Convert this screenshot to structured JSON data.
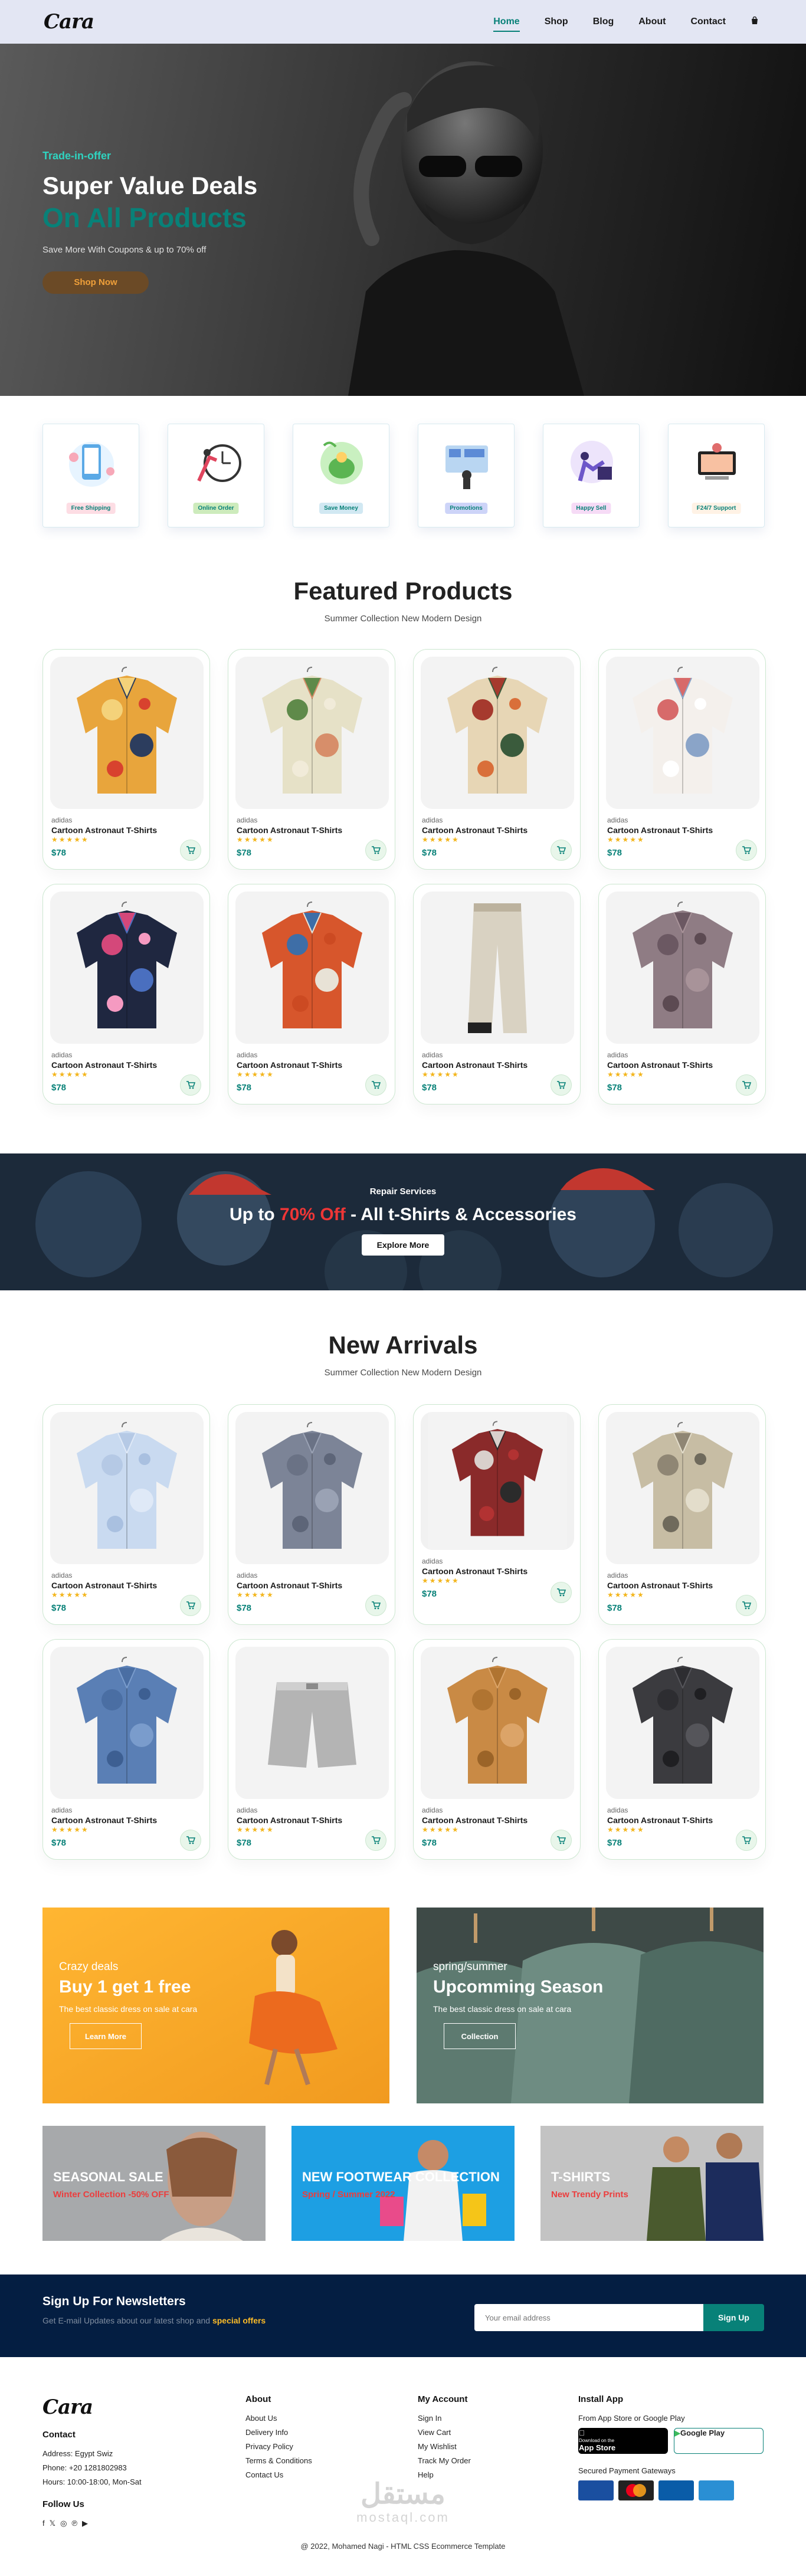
{
  "header": {
    "logo": "Cara",
    "nav": [
      "Home",
      "Shop",
      "Blog",
      "About",
      "Contact"
    ],
    "active": "Home",
    "cart_icon": "shopping-bag-icon"
  },
  "hero": {
    "kicker": "Trade-in-offer",
    "title1": "Super Value Deals",
    "title2": "On All Products",
    "text": "Save More With Coupons & up to 70% off",
    "button": "Shop Now"
  },
  "features": [
    {
      "label": "Free Shipping",
      "bg": "#fddde4"
    },
    {
      "label": "Online Order",
      "bg": "#cdebbc"
    },
    {
      "label": "Save Money",
      "bg": "#d1e8f2"
    },
    {
      "label": "Promotions",
      "bg": "#cdd4f8"
    },
    {
      "label": "Happy Sell",
      "bg": "#f6dbf6"
    },
    {
      "label": "F24/7 Support",
      "bg": "#fff2e5"
    }
  ],
  "featured": {
    "title": "Featured Products",
    "subtitle": "Summer Collection New Modern Design"
  },
  "product": {
    "brand": "adidas",
    "name": "Cartoon Astronaut T-Shirts",
    "stars": "★★★★★",
    "price": "$78"
  },
  "banner": {
    "kicker": "Repair Services",
    "pre": "Up to",
    "highlight": "70% Off",
    "post": "- All t-Shirts & Accessories",
    "button": "Explore More"
  },
  "arrivals": {
    "title": "New Arrivals",
    "subtitle": "Summer Collection New Modern Design"
  },
  "promo1": {
    "t1": "Crazy deals",
    "t2": "Buy 1 get 1 free",
    "t3": "The best classic dress on sale at cara",
    "button": "Learn More"
  },
  "promo2": {
    "t1": "spring/summer",
    "t2": "Upcomming Season",
    "t3": "The best classic dress on sale at cara",
    "button": "Collection"
  },
  "banners3": [
    {
      "title": "SEASONAL SALE",
      "sub": "Winter Collection -50% OFF"
    },
    {
      "title": "NEW FOOTWEAR COLLECTION",
      "sub": "Spring / Summer 2022"
    },
    {
      "title": "T-SHIRTS",
      "sub": "New Trendy Prints"
    }
  ],
  "newsletter": {
    "title": "Sign Up For Newsletters",
    "text_pre": "Get E-mail Updates about our latest shop and",
    "text_b": "special offers",
    "placeholder": "Your email address",
    "button": "Sign Up"
  },
  "footer": {
    "contact": {
      "title": "Contact",
      "address": "Address: Egypt Swiz",
      "phone": "Phone: +20 1281802983",
      "hours": "Hours: 10:00-18:00, Mon-Sat",
      "follow": "Follow Us"
    },
    "about": {
      "title": "About",
      "links": [
        "About Us",
        "Delivery Info",
        "Privacy Policy",
        "Terms & Conditions",
        "Contact Us"
      ]
    },
    "account": {
      "title": "My Account",
      "links": [
        "Sign In",
        "View Cart",
        "My Wishlist",
        "Track My Order",
        "Help"
      ]
    },
    "app": {
      "title": "Install App",
      "text": "From App Store or Google Play",
      "appstore": "App Store",
      "appstore_small": "Download on the",
      "googleplay": "Google Play",
      "secured": "Secured Payment Gateways"
    },
    "copyright": "@ 2022, Mohamed Nagi - HTML CSS Ecommerce Template",
    "watermark": "مستقل",
    "watermark_sub": "mostaql.com"
  },
  "colors": {
    "accent": "#088178",
    "header_bg": "#e3e6f3",
    "newsletter_bg": "#041e42"
  }
}
